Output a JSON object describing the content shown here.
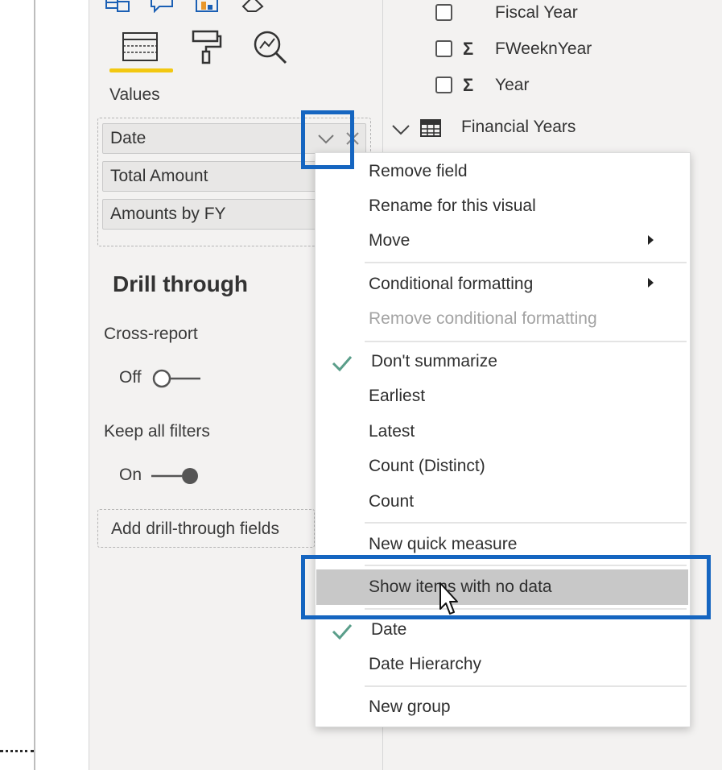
{
  "canvas": {
    "background": "#ffffff"
  },
  "viz_pane": {
    "top_icons": [
      "table-icon",
      "chat-icon",
      "chart-icon",
      "eraser-icon",
      "more-icon"
    ],
    "tabs": [
      {
        "name": "fields-tab",
        "icon": "grid-icon",
        "active": true
      },
      {
        "name": "format-tab",
        "icon": "paint-roller-icon",
        "active": false
      },
      {
        "name": "analytics-tab",
        "icon": "magnifier-chart-icon",
        "active": false
      }
    ],
    "accent_color": "#f2c811",
    "values_label": "Values",
    "values_fields": [
      "Date",
      "Total Amount",
      "Amounts by FY"
    ],
    "drill_through": {
      "title": "Drill through",
      "cross_report_label": "Cross-report",
      "cross_report_state": "Off",
      "keep_filters_label": "Keep all filters",
      "keep_filters_state": "On",
      "add_fields_placeholder": "Add drill-through fields"
    }
  },
  "fields_pane": {
    "items": [
      {
        "label": "Fiscal Year",
        "sigma": false
      },
      {
        "label": "FWeeknYear",
        "sigma": true
      },
      {
        "label": "Year",
        "sigma": true
      }
    ],
    "table_label": "Financial Years"
  },
  "context_menu": {
    "items": [
      {
        "label": "Remove field"
      },
      {
        "label": "Rename for this visual"
      },
      {
        "label": "Move",
        "submenu": true
      },
      {
        "label": "Conditional formatting",
        "submenu": true
      },
      {
        "label": "Remove conditional formatting",
        "disabled": true
      },
      {
        "label": "Don't summarize",
        "checked": true
      },
      {
        "label": "Earliest"
      },
      {
        "label": "Latest"
      },
      {
        "label": "Count (Distinct)"
      },
      {
        "label": "Count"
      },
      {
        "label": "New quick measure"
      },
      {
        "label": "Show items with no data",
        "hovered": true
      },
      {
        "label": "Date",
        "checked": true
      },
      {
        "label": "Date Hierarchy"
      },
      {
        "label": "New group"
      }
    ],
    "check_color": "#5a9e8a",
    "hover_color": "#c8c8c8"
  },
  "annotation_color": "#1565c0"
}
